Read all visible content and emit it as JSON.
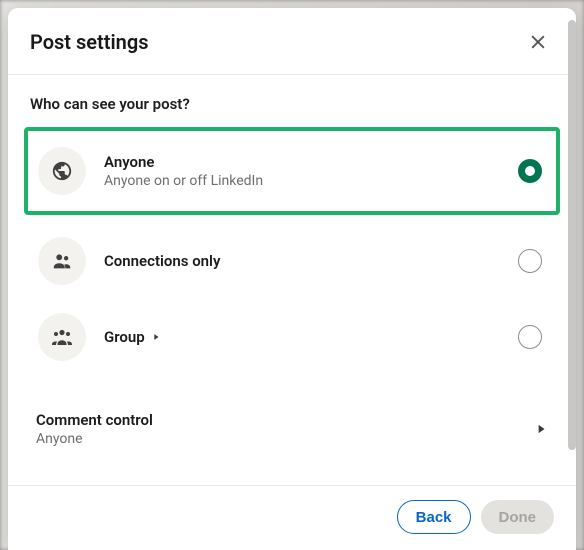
{
  "modal": {
    "title": "Post settings",
    "section_heading": "Who can see your post?",
    "options": [
      {
        "title": "Anyone",
        "subtitle": "Anyone on or off LinkedIn",
        "icon": "globe",
        "selected": true,
        "highlighted": true,
        "has_chevron": false
      },
      {
        "title": "Connections only",
        "subtitle": "",
        "icon": "two-people",
        "selected": false,
        "highlighted": false,
        "has_chevron": false
      },
      {
        "title": "Group",
        "subtitle": "",
        "icon": "three-people",
        "selected": false,
        "highlighted": false,
        "has_chevron": true
      }
    ],
    "comment_control": {
      "title": "Comment control",
      "value": "Anyone"
    },
    "footer": {
      "back_label": "Back",
      "done_label": "Done"
    }
  },
  "colors": {
    "highlight_border": "#1fb06b",
    "radio_selected": "#01754f",
    "primary_blue": "#0a66c2"
  }
}
